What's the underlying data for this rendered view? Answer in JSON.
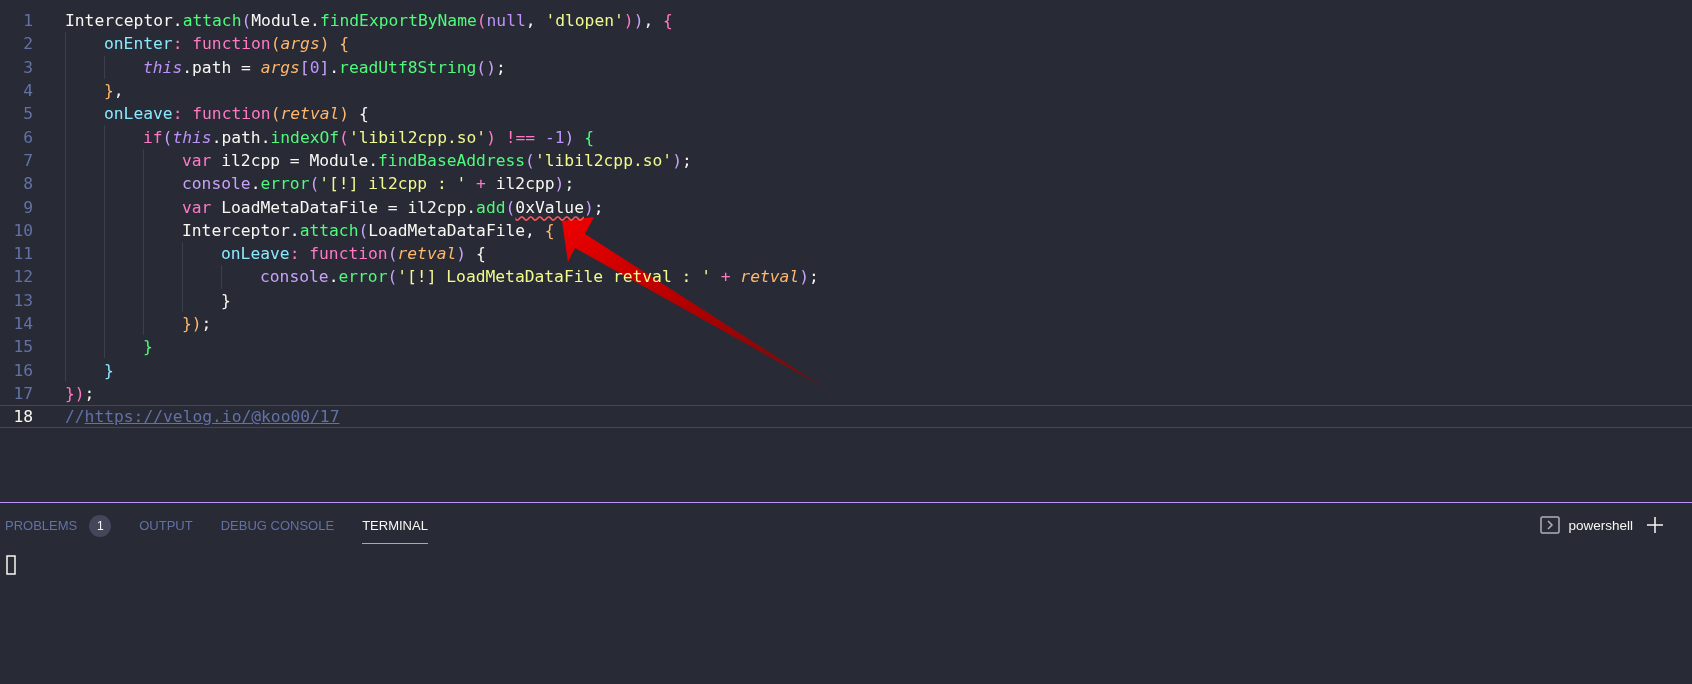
{
  "editor": {
    "lines": [
      {
        "number": "1",
        "current": false,
        "tokens": [
          {
            "t": "Interceptor.",
            "kind": "plain"
          },
          {
            "t": "attach",
            "kind": "fn"
          },
          {
            "t": "(",
            "kind": "b1"
          },
          {
            "t": "Module.",
            "kind": "plain"
          },
          {
            "t": "findExportByName",
            "kind": "fn"
          },
          {
            "t": "(",
            "kind": "b2"
          },
          {
            "t": "null",
            "kind": "const"
          },
          {
            "t": ", ",
            "kind": "plain"
          },
          {
            "t": "'dlopen'",
            "kind": "str"
          },
          {
            "t": ")",
            "kind": "b2"
          },
          {
            "t": ")",
            "kind": "b1"
          },
          {
            "t": ", ",
            "kind": "plain"
          },
          {
            "t": "{",
            "kind": "b2"
          }
        ],
        "children": [
          {
            "number": "2",
            "current": false,
            "tokens": [
              {
                "t": "onEnter",
                "kind": "prop"
              },
              {
                "t": ": ",
                "kind": "kw"
              },
              {
                "t": "function",
                "kind": "kw"
              },
              {
                "t": "(",
                "kind": "b3"
              },
              {
                "t": "args",
                "kind": "param"
              },
              {
                "t": ")",
                "kind": "b3"
              },
              {
                "t": " {",
                "kind": "b3"
              }
            ],
            "children": [
              {
                "number": "3",
                "current": false,
                "tokens": [
                  {
                    "t": "this",
                    "kind": "self"
                  },
                  {
                    "t": ".path = ",
                    "kind": "plain"
                  },
                  {
                    "t": "args",
                    "kind": "param"
                  },
                  {
                    "t": "[",
                    "kind": "b1"
                  },
                  {
                    "t": "0",
                    "kind": "const"
                  },
                  {
                    "t": "]",
                    "kind": "b1"
                  },
                  {
                    "t": ".",
                    "kind": "plain"
                  },
                  {
                    "t": "readUtf8String",
                    "kind": "fn"
                  },
                  {
                    "t": "()",
                    "kind": "b1"
                  },
                  {
                    "t": ";",
                    "kind": "plain"
                  }
                ]
              }
            ]
          },
          {
            "number": "4",
            "current": false,
            "tokens": [
              {
                "t": "}",
                "kind": "b3"
              },
              {
                "t": ",",
                "kind": "plain"
              }
            ]
          },
          {
            "number": "5",
            "current": false,
            "tokens": [
              {
                "t": "onLeave",
                "kind": "prop"
              },
              {
                "t": ": ",
                "kind": "kw"
              },
              {
                "t": "function",
                "kind": "kw"
              },
              {
                "t": "(",
                "kind": "b3"
              },
              {
                "t": "retval",
                "kind": "param"
              },
              {
                "t": ")",
                "kind": "b3"
              },
              {
                "t": " {",
                "kind": "plain"
              }
            ],
            "children": [
              {
                "number": "6",
                "current": false,
                "tokens": [
                  {
                    "t": "if",
                    "kind": "kw"
                  },
                  {
                    "t": "(",
                    "kind": "b1"
                  },
                  {
                    "t": "this",
                    "kind": "self"
                  },
                  {
                    "t": ".path.",
                    "kind": "plain"
                  },
                  {
                    "t": "indexOf",
                    "kind": "fn"
                  },
                  {
                    "t": "(",
                    "kind": "b2"
                  },
                  {
                    "t": "'libil2cpp.so'",
                    "kind": "str"
                  },
                  {
                    "t": ")",
                    "kind": "b2"
                  },
                  {
                    "t": " !== ",
                    "kind": "kw"
                  },
                  {
                    "t": "-1",
                    "kind": "const"
                  },
                  {
                    "t": ")",
                    "kind": "b1"
                  },
                  {
                    "t": " {",
                    "kind": "b4"
                  }
                ],
                "children": [
                  {
                    "number": "7",
                    "current": false,
                    "tokens": [
                      {
                        "t": "var",
                        "kind": "kw"
                      },
                      {
                        "t": " il2cpp = Module.",
                        "kind": "plain"
                      },
                      {
                        "t": "findBaseAddress",
                        "kind": "fn"
                      },
                      {
                        "t": "(",
                        "kind": "b1"
                      },
                      {
                        "t": "'libil2cpp.so'",
                        "kind": "str"
                      },
                      {
                        "t": ")",
                        "kind": "b1"
                      },
                      {
                        "t": ";",
                        "kind": "plain"
                      }
                    ]
                  },
                  {
                    "number": "8",
                    "current": false,
                    "tokens": [
                      {
                        "t": "console",
                        "kind": "obj"
                      },
                      {
                        "t": ".",
                        "kind": "plain"
                      },
                      {
                        "t": "error",
                        "kind": "fn"
                      },
                      {
                        "t": "(",
                        "kind": "b1"
                      },
                      {
                        "t": "'[!] il2cpp : '",
                        "kind": "str"
                      },
                      {
                        "t": " + ",
                        "kind": "kw"
                      },
                      {
                        "t": "il2cpp",
                        "kind": "plain"
                      },
                      {
                        "t": ")",
                        "kind": "b1"
                      },
                      {
                        "t": ";",
                        "kind": "plain"
                      }
                    ]
                  },
                  {
                    "number": "9",
                    "current": false,
                    "tokens": [
                      {
                        "t": "var",
                        "kind": "kw"
                      },
                      {
                        "t": " LoadMetaDataFile = il2cpp.",
                        "kind": "plain"
                      },
                      {
                        "t": "add",
                        "kind": "fn"
                      },
                      {
                        "t": "(",
                        "kind": "b1"
                      },
                      {
                        "t": "0xValue",
                        "kind": "plain",
                        "error": true
                      },
                      {
                        "t": ")",
                        "kind": "b1"
                      },
                      {
                        "t": ";",
                        "kind": "plain"
                      }
                    ]
                  },
                  {
                    "number": "10",
                    "current": false,
                    "tokens": [
                      {
                        "t": "Interceptor.",
                        "kind": "plain"
                      },
                      {
                        "t": "attach",
                        "kind": "fn"
                      },
                      {
                        "t": "(",
                        "kind": "b1"
                      },
                      {
                        "t": "LoadMetaDataFile, ",
                        "kind": "plain"
                      },
                      {
                        "t": "{",
                        "kind": "b3"
                      }
                    ],
                    "children": [
                      {
                        "number": "11",
                        "current": false,
                        "tokens": [
                          {
                            "t": "onLeave",
                            "kind": "prop"
                          },
                          {
                            "t": ": ",
                            "kind": "kw"
                          },
                          {
                            "t": "function",
                            "kind": "kw"
                          },
                          {
                            "t": "(",
                            "kind": "b1"
                          },
                          {
                            "t": "retval",
                            "kind": "param"
                          },
                          {
                            "t": ")",
                            "kind": "b1"
                          },
                          {
                            "t": " {",
                            "kind": "plain"
                          }
                        ],
                        "children": [
                          {
                            "number": "12",
                            "current": false,
                            "tokens": [
                              {
                                "t": "console",
                                "kind": "obj"
                              },
                              {
                                "t": ".",
                                "kind": "plain"
                              },
                              {
                                "t": "error",
                                "kind": "fn"
                              },
                              {
                                "t": "(",
                                "kind": "b1"
                              },
                              {
                                "t": "'[!] LoadMetaDataFile retval : '",
                                "kind": "str"
                              },
                              {
                                "t": " + ",
                                "kind": "kw"
                              },
                              {
                                "t": "retval",
                                "kind": "param"
                              },
                              {
                                "t": ")",
                                "kind": "b1"
                              },
                              {
                                "t": ";",
                                "kind": "plain"
                              }
                            ]
                          }
                        ]
                      },
                      {
                        "number": "13",
                        "current": false,
                        "tokens": [
                          {
                            "t": "}",
                            "kind": "plain"
                          }
                        ]
                      }
                    ]
                  },
                  {
                    "number": "14",
                    "current": false,
                    "tokens": [
                      {
                        "t": "})",
                        "kind": "b3"
                      },
                      {
                        "t": ";",
                        "kind": "plain"
                      }
                    ]
                  }
                ]
              },
              {
                "number": "15",
                "current": false,
                "tokens": [
                  {
                    "t": "}",
                    "kind": "b4"
                  }
                ]
              }
            ]
          },
          {
            "number": "16",
            "current": false,
            "tokens": [
              {
                "t": "}",
                "kind": "b5"
              }
            ]
          }
        ]
      },
      {
        "number": "17",
        "current": false,
        "tokens": [
          {
            "t": "})",
            "kind": "b2"
          },
          {
            "t": ";",
            "kind": "plain"
          }
        ]
      },
      {
        "number": "18",
        "current": true,
        "tokens": [
          {
            "t": "//",
            "kind": "comment"
          },
          {
            "t": "https://velog.io/@koo00/17",
            "kind": "link"
          }
        ]
      }
    ]
  },
  "panel": {
    "tabs": [
      {
        "label": "PROBLEMS",
        "badge": "1",
        "selected": false
      },
      {
        "label": "OUTPUT",
        "selected": false
      },
      {
        "label": "DEBUG CONSOLE",
        "selected": false
      },
      {
        "label": "TERMINAL",
        "selected": true
      }
    ],
    "terminal_name": "powershell"
  }
}
